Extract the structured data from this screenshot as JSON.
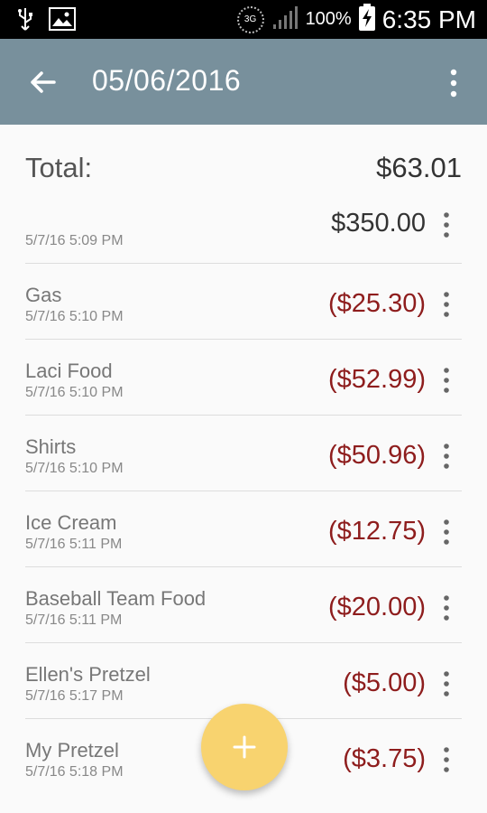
{
  "status_bar": {
    "network": "3G",
    "battery": "100%",
    "time": "6:35 PM"
  },
  "toolbar": {
    "title": "05/06/2016",
    "back_icon": "arrow-left-icon",
    "overflow_icon": "more-vertical-icon"
  },
  "summary": {
    "total_label": "Total:",
    "total_value": "$63.01"
  },
  "colors": {
    "appbar": "#78909c",
    "negative": "#8e1d1d",
    "fab": "#f8d36f"
  },
  "transactions": [
    {
      "name": "",
      "date": "5/7/16 5:09 PM",
      "amount": "$350.00",
      "type": "income"
    },
    {
      "name": "Gas",
      "date": "5/7/16 5:10 PM",
      "amount": "($25.30)",
      "type": "expense"
    },
    {
      "name": "Laci Food",
      "date": "5/7/16 5:10 PM",
      "amount": "($52.99)",
      "type": "expense"
    },
    {
      "name": "Shirts",
      "date": "5/7/16 5:10 PM",
      "amount": "($50.96)",
      "type": "expense"
    },
    {
      "name": "Ice Cream",
      "date": "5/7/16 5:11 PM",
      "amount": "($12.75)",
      "type": "expense"
    },
    {
      "name": "Baseball Team Food",
      "date": "5/7/16 5:11 PM",
      "amount": "($20.00)",
      "type": "expense"
    },
    {
      "name": "Ellen's Pretzel",
      "date": "5/7/16 5:17 PM",
      "amount": "($5.00)",
      "type": "expense"
    },
    {
      "name": "My Pretzel",
      "date": "5/7/16 5:18 PM",
      "amount": "($3.75)",
      "type": "expense"
    }
  ],
  "fab": {
    "icon": "plus-icon"
  }
}
